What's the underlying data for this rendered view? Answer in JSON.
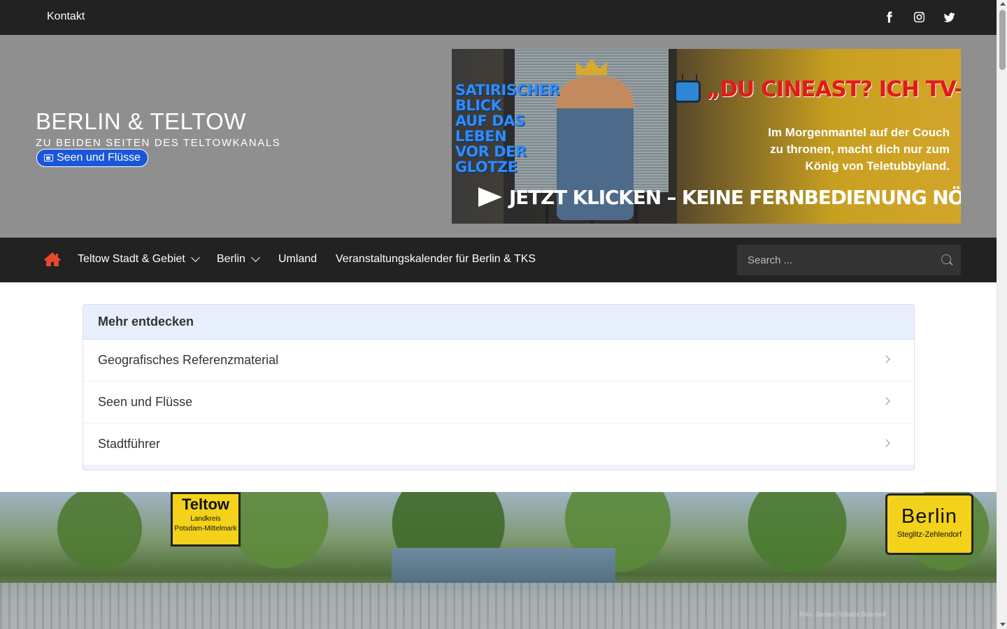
{
  "topbar": {
    "contact_label": "Kontakt",
    "social": [
      {
        "icon": "facebook-icon"
      },
      {
        "icon": "instagram-icon"
      },
      {
        "icon": "twitter-icon"
      }
    ]
  },
  "header": {
    "site_title": "BERLIN & TELTOW",
    "tagline": "ZU BEIDEN SEITEN DES TELTOWKANALS",
    "badge_label": "Seen und Flüsse"
  },
  "banner": {
    "left_text": "Satirischer Blick auf das Leben vor der Glotze",
    "headline": "„DU CINEAST? ICH TV-IST!“",
    "sub_lines": [
      "Im Morgenmantel auf der Couch",
      "zu thronen, macht dich nur zum",
      "König von Teletubbyland."
    ],
    "cta": "JETZT KLICKEN – KEINE FERNBEDIENUNG NÖTIG"
  },
  "nav": {
    "items": [
      {
        "label": "Teltow Stadt & Gebiet",
        "has_dropdown": true
      },
      {
        "label": "Berlin",
        "has_dropdown": true
      },
      {
        "label": "Umland",
        "has_dropdown": false
      },
      {
        "label": "Veranstaltungskalender für Berlin & TKS",
        "has_dropdown": false
      }
    ],
    "search_placeholder": "Search ..."
  },
  "discover": {
    "title": "Mehr entdecken",
    "items": [
      "Geografisches Referenzmaterial",
      "Seen und Flüsse",
      "Stadtführer"
    ]
  },
  "hero": {
    "sign_teltow": {
      "name": "Teltow",
      "line1": "Landkreis",
      "line2": "Potsdam-Mittelmark"
    },
    "sign_berlin": {
      "name": "Berlin",
      "district": "Steglitz-Zehlendorf"
    },
    "credit": "Foto: Jochen Schulze Buschoff"
  },
  "colors": {
    "topbar_bg": "#222222",
    "header_bg": "#8f8f8f",
    "accent_home": "#e8482e",
    "badge_bg": "#1a56db",
    "discover_head_bg": "#e7effd"
  }
}
